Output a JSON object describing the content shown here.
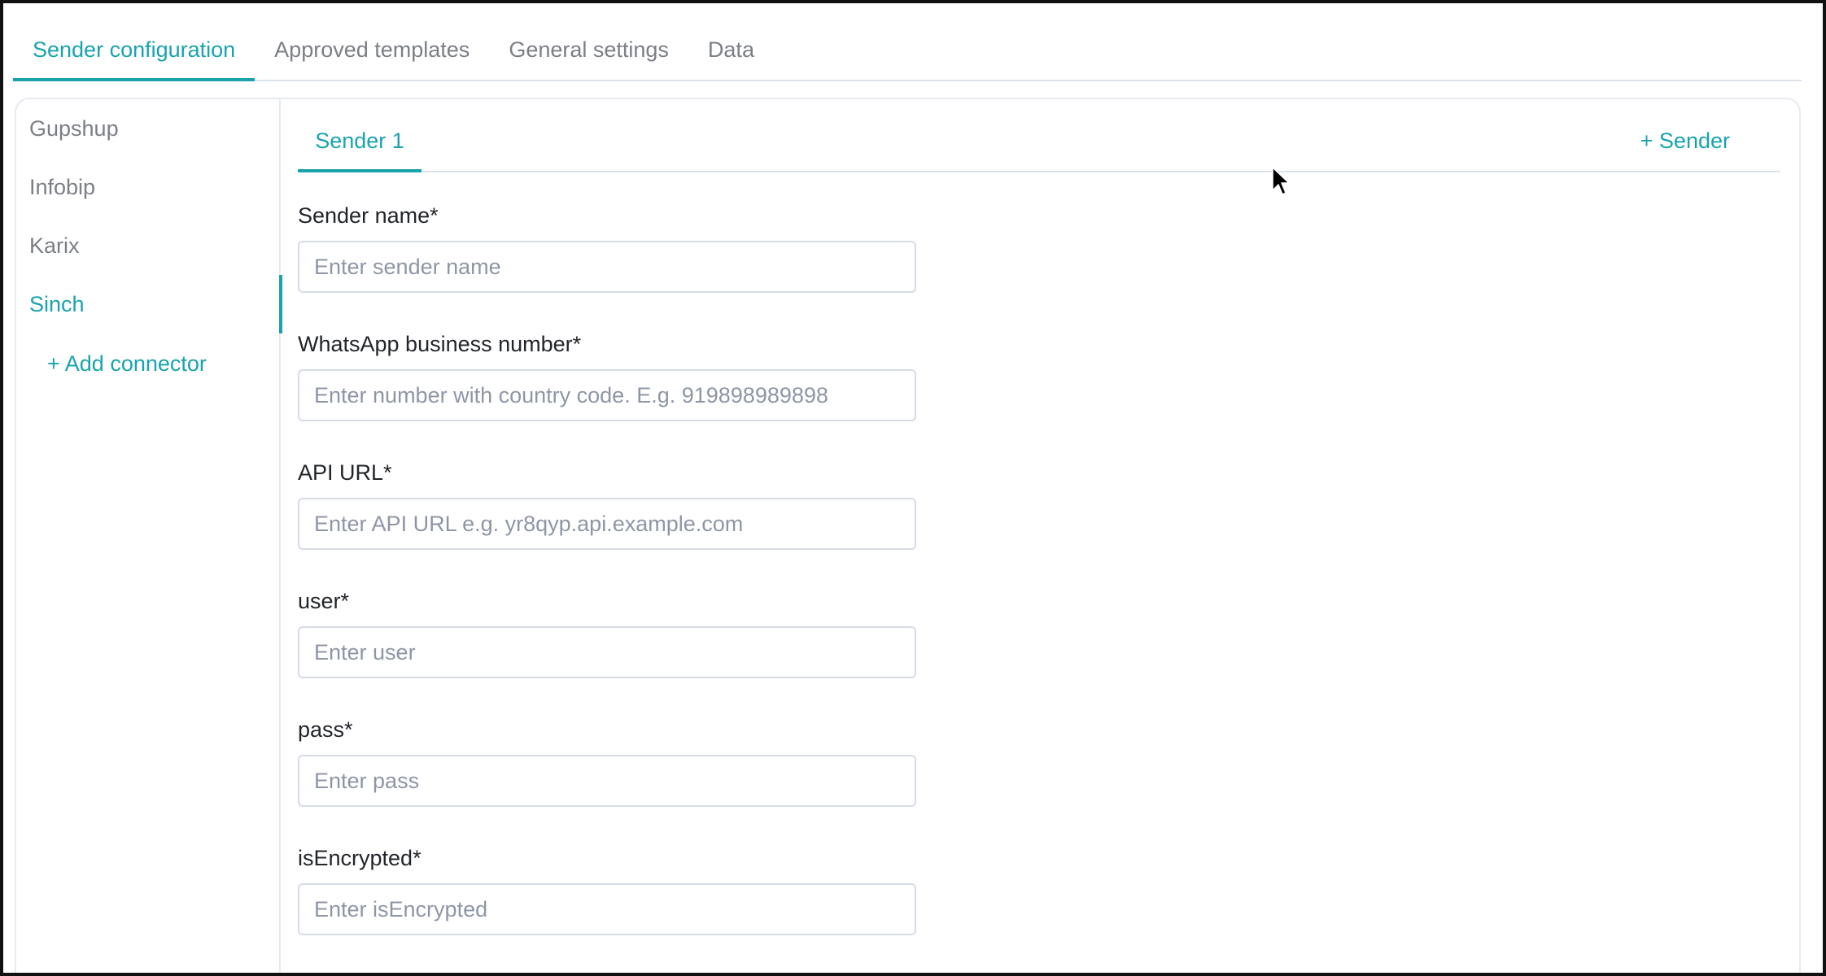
{
  "top_tabs": [
    {
      "label": "Sender configuration",
      "active": true
    },
    {
      "label": "Approved templates",
      "active": false
    },
    {
      "label": "General settings",
      "active": false
    },
    {
      "label": "Data",
      "active": false
    }
  ],
  "sidebar": {
    "items": [
      {
        "label": "Gupshup",
        "active": false
      },
      {
        "label": "Infobip",
        "active": false
      },
      {
        "label": "Karix",
        "active": false
      },
      {
        "label": "Sinch",
        "active": true
      }
    ],
    "add_connector": "+ Add connector"
  },
  "sender_tabs": {
    "active": "Sender 1",
    "add_sender": "+ Sender"
  },
  "form": {
    "fields": [
      {
        "label": "Sender name*",
        "value": "",
        "placeholder": "Enter sender name"
      },
      {
        "label": "WhatsApp business number*",
        "value": "",
        "placeholder": "Enter number with country code. E.g. 919898989898"
      },
      {
        "label": "API URL*",
        "value": "",
        "placeholder": "Enter API URL e.g. yr8qyp.api.example.com"
      },
      {
        "label": "user*",
        "value": "",
        "placeholder": "Enter user"
      },
      {
        "label": "pass*",
        "value": "",
        "placeholder": "Enter pass"
      },
      {
        "label": "isEncrypted*",
        "value": "",
        "placeholder": "Enter isEncrypted"
      }
    ]
  },
  "colors": {
    "accent": "#1aa3ad",
    "muted_text": "#7b7f86",
    "border": "#e7ebf0"
  },
  "icons": {
    "cursor": "mouse-pointer-icon"
  }
}
